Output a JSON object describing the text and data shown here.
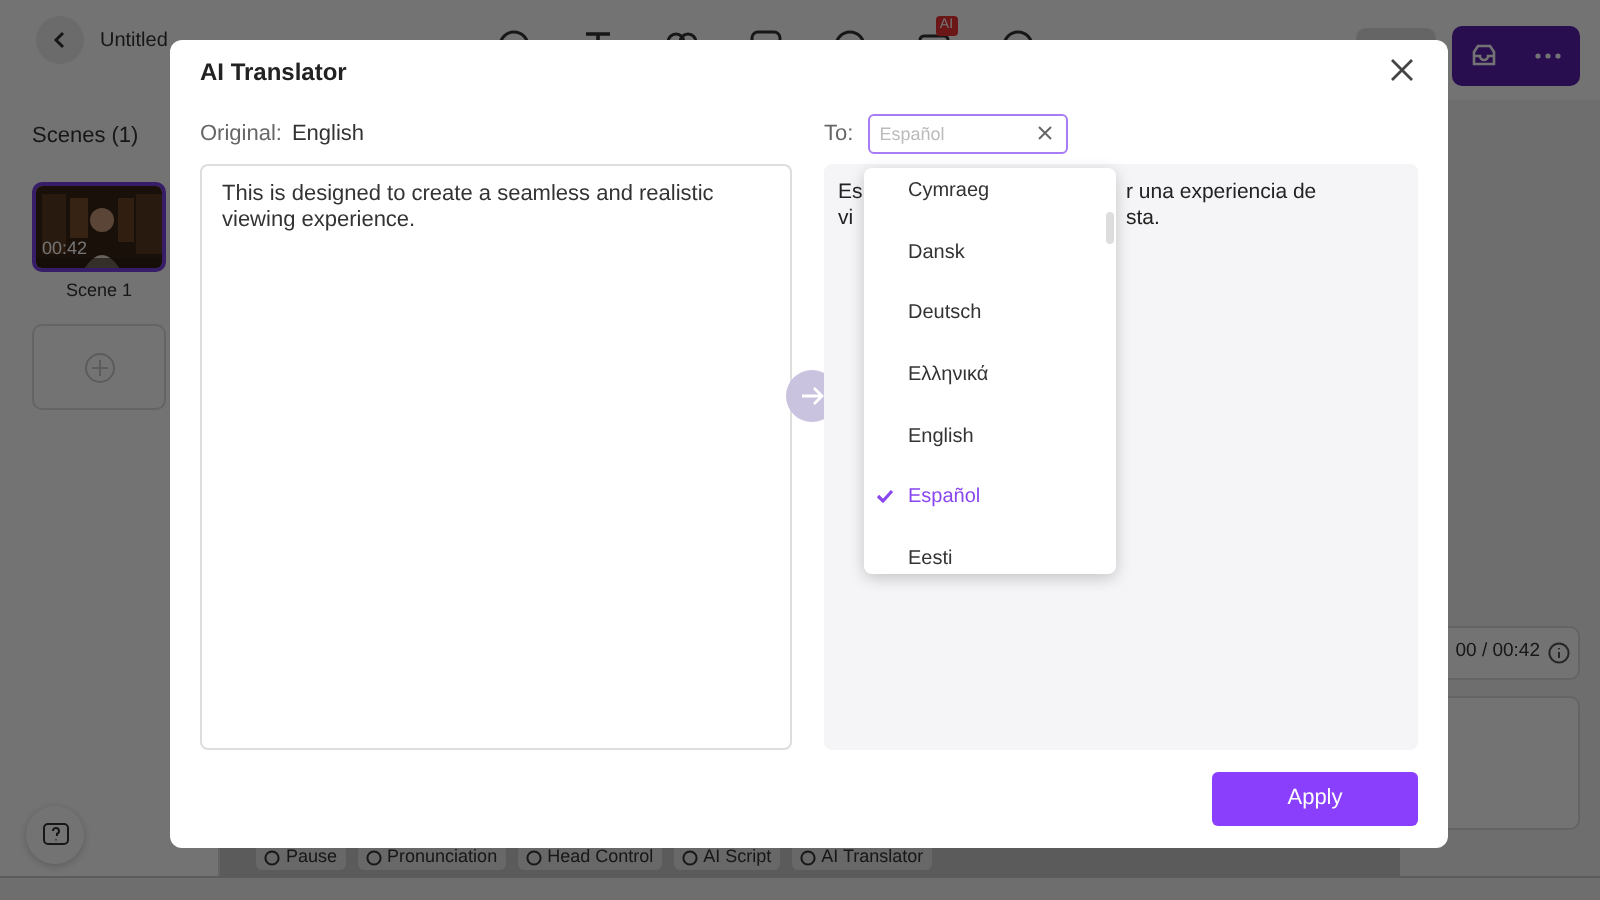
{
  "app": {
    "document_title": "Untitled",
    "ai_badge": "AI",
    "sidebar": {
      "heading": "Scenes (1)",
      "scenes": [
        {
          "duration": "00:42",
          "label": "Scene 1",
          "selected": true
        }
      ]
    },
    "timecode": "00 / 00:42",
    "bottom_toolbar": [
      "Pause",
      "Pronunciation",
      "Head Control",
      "AI Script",
      "AI Translator"
    ]
  },
  "dialog": {
    "title": "AI Translator",
    "original_label": "Original:",
    "original_language": "English",
    "source_text": "This is designed to create a seamless and realistic viewing experience.",
    "to_label": "To:",
    "target_field": {
      "placeholder": "Español"
    },
    "output_fragments": [
      {
        "left": "Es",
        "right": "r una experiencia de"
      },
      {
        "left": "vi",
        "right": "sta."
      }
    ],
    "language_options": [
      {
        "label": "Cymraeg",
        "selected": false
      },
      {
        "label": "Dansk",
        "selected": false
      },
      {
        "label": "Deutsch",
        "selected": false
      },
      {
        "label": "Ελληνικά",
        "selected": false
      },
      {
        "label": "English",
        "selected": false
      },
      {
        "label": "Español",
        "selected": true
      },
      {
        "label": "Eesti",
        "selected": false
      }
    ],
    "apply_button": "Apply"
  }
}
